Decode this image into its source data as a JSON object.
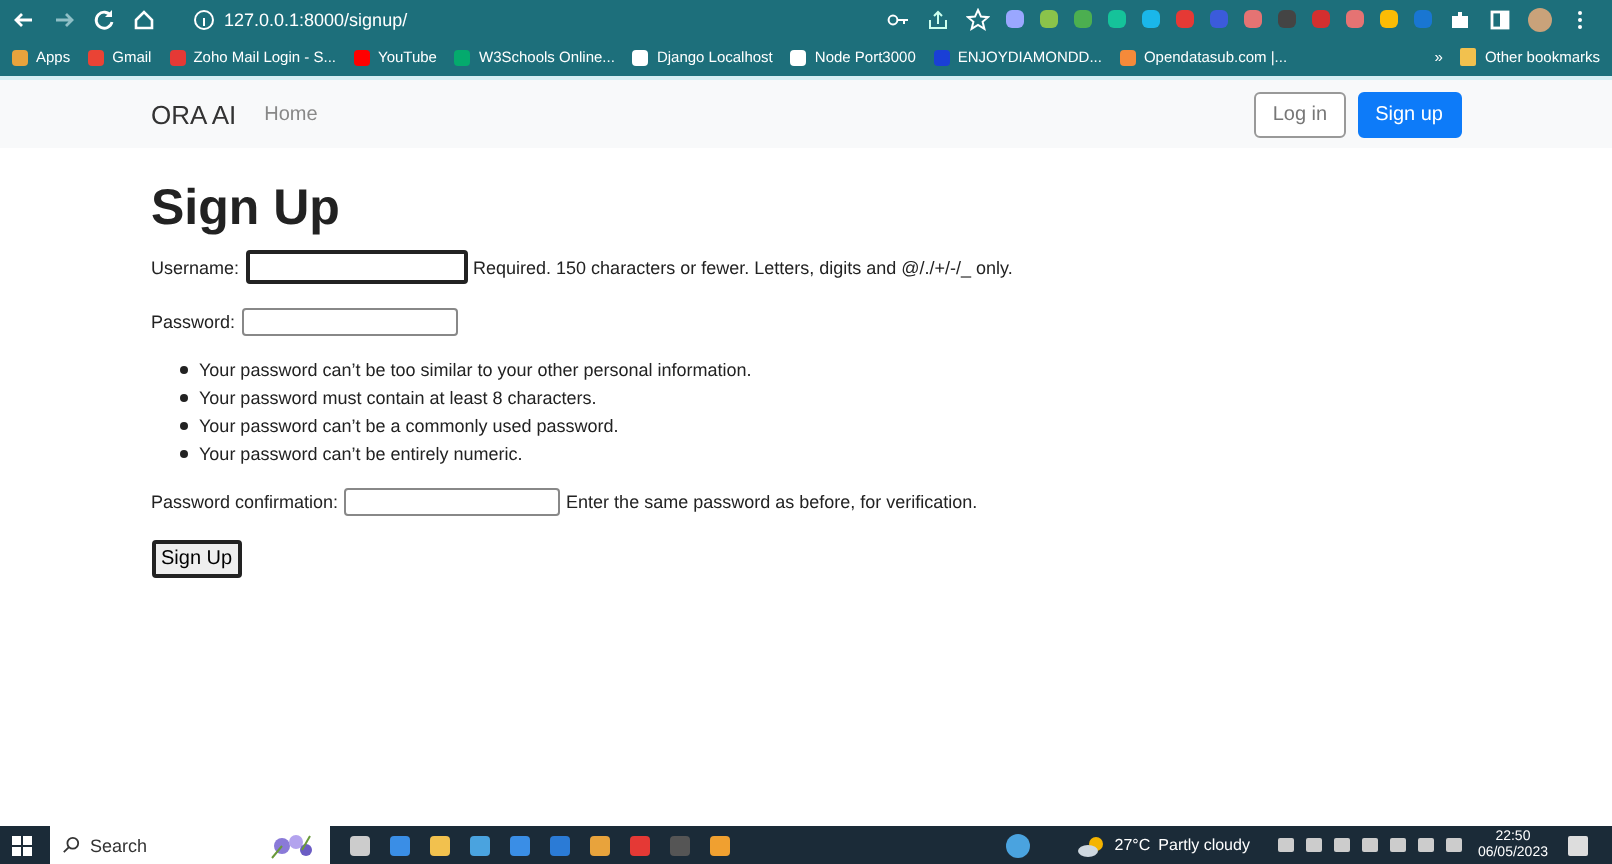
{
  "browser": {
    "url": "127.0.0.1:8000/signup/",
    "bookmarks": [
      {
        "label": "Apps",
        "color": "#e8a33c"
      },
      {
        "label": "Gmail",
        "color": "#ea4335"
      },
      {
        "label": "Zoho Mail Login - S...",
        "color": "#e53935"
      },
      {
        "label": "YouTube",
        "color": "#ff0000"
      },
      {
        "label": "W3Schools Online...",
        "color": "#04aa6d"
      },
      {
        "label": "Django Localhost",
        "color": "#ffffff"
      },
      {
        "label": "Node Port3000",
        "color": "#ffffff"
      },
      {
        "label": "ENJOYDIAMONDD...",
        "color": "#1a3fd6"
      },
      {
        "label": "Opendatasub.com |...",
        "color": "#f58a3a"
      }
    ],
    "overflow": "»",
    "other_bookmarks": "Other bookmarks"
  },
  "navbar": {
    "brand": "ORA AI",
    "links": [
      "Home"
    ],
    "login": "Log in",
    "signup": "Sign up"
  },
  "form": {
    "title": "Sign Up",
    "fields": [
      {
        "label": "Username:",
        "focused": true,
        "help": "Required. 150 characters or fewer. Letters, digits and @/./+/-/_ only."
      },
      {
        "label": "Password:",
        "focused": false
      },
      {
        "kind": "rules",
        "items": [
          "Your password can’t be too similar to your other personal information.",
          "Your password must contain at least 8 characters.",
          "Your password can’t be a commonly used password.",
          "Your password can’t be entirely numeric."
        ]
      },
      {
        "label": "Password confirmation:",
        "focused": false,
        "help": "Enter the same password as before, for verification."
      }
    ],
    "submit": "Sign Up"
  },
  "taskbar": {
    "search_placeholder": "Search",
    "temperature": "27°C",
    "weather": "Partly cloudy",
    "time": "22:50",
    "date": "06/05/2023"
  }
}
